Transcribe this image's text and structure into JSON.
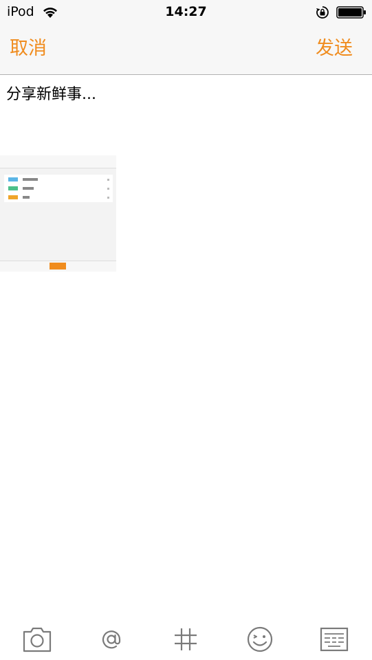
{
  "status_bar": {
    "carrier": "iPod",
    "time": "14:27"
  },
  "nav": {
    "cancel_label": "取消",
    "send_label": "发送"
  },
  "compose": {
    "placeholder": "分享新鲜事..."
  },
  "colors": {
    "accent": "#f08c1e",
    "nav_background": "#f7f7f7",
    "divider": "#b2b2b2",
    "icon_gray": "#7a7a7a"
  },
  "toolbar": {
    "icons": [
      "camera-icon",
      "at-icon",
      "hashtag-icon",
      "emoji-icon",
      "keyboard-icon"
    ]
  }
}
